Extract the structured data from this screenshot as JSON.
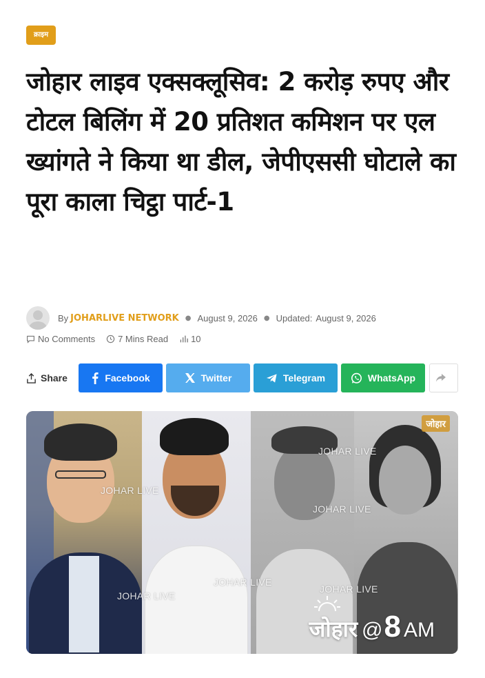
{
  "category": {
    "label": "क्राइम"
  },
  "article": {
    "title": "जोहार लाइव एक्सक्लूसिव: 2 करोड़ रुपए और टोटल बिलिंग में 20 प्रतिशत कमिशन पर एल ख्यांगते ने किया था डील, जेपीएससी घोटाले का पूरा काला चिट्ठा पार्ट-1"
  },
  "meta": {
    "by_label": "By",
    "author": "JOHARLIVE NETWORK",
    "date": "August 9, 2026",
    "updated_label": "Updated:",
    "updated_date": "August 9, 2026"
  },
  "stats": {
    "comments": "No Comments",
    "read_time": "7 Mins Read",
    "views": "10"
  },
  "share": {
    "label": "Share",
    "buttons": [
      {
        "label": "Facebook",
        "color": "#1877f2",
        "icon": "facebook-icon"
      },
      {
        "label": "Twitter",
        "color": "#55acee",
        "icon": "x-twitter-icon"
      },
      {
        "label": "Telegram",
        "color": "#2a9fd6",
        "icon": "telegram-icon"
      },
      {
        "label": "WhatsApp",
        "color": "#25b45a",
        "icon": "whatsapp-icon"
      }
    ],
    "more_icon": "forward-arrow-icon"
  },
  "hero": {
    "watermark": "JOHAR LIVE",
    "logo_badge": "जोहार",
    "brand_hindi": "जोहार",
    "brand_at": "@",
    "brand_number": "8",
    "brand_suffix": "AM"
  },
  "colors": {
    "accent": "#e19e1a"
  }
}
